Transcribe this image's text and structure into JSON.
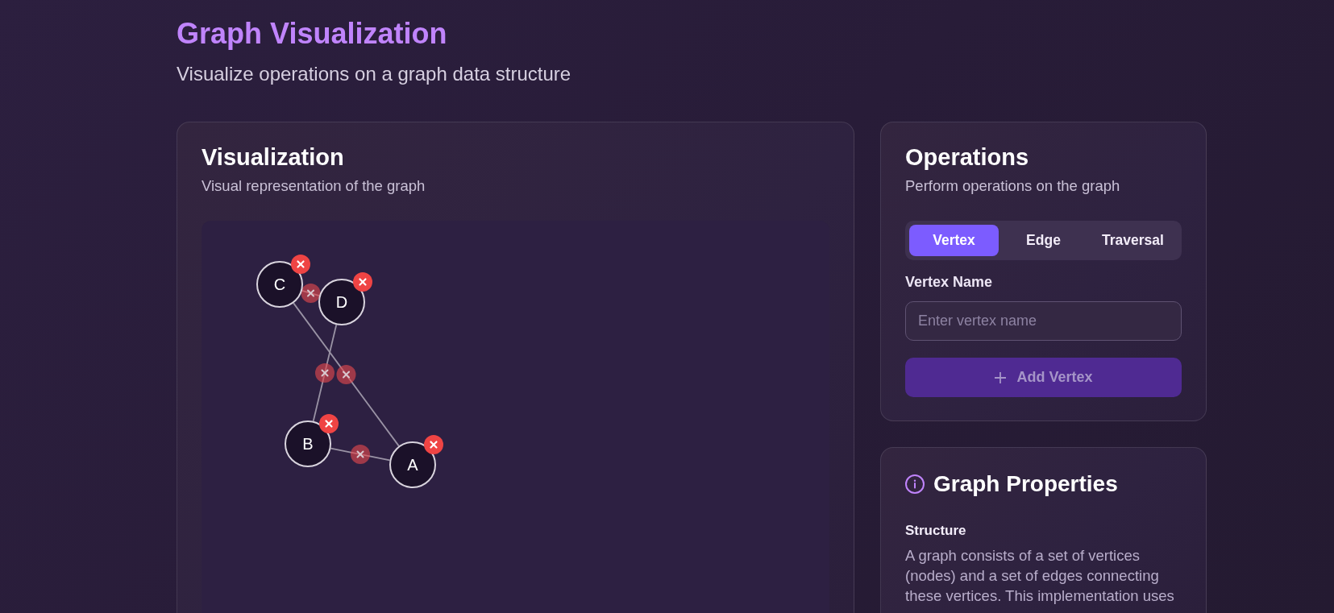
{
  "header": {
    "title": "Graph Visualization",
    "subtitle": "Visualize operations on a graph data structure"
  },
  "visualization": {
    "title": "Visualization",
    "subtitle": "Visual representation of the graph",
    "vertices": [
      {
        "label": "A"
      },
      {
        "label": "B"
      },
      {
        "label": "C"
      },
      {
        "label": "D"
      }
    ]
  },
  "operations": {
    "title": "Operations",
    "subtitle": "Perform operations on the graph",
    "tabs": [
      {
        "label": "Vertex",
        "selected": true
      },
      {
        "label": "Edge",
        "selected": false
      },
      {
        "label": "Traversal",
        "selected": false
      }
    ],
    "field": {
      "label": "Vertex Name",
      "placeholder": "Enter vertex name"
    },
    "button": {
      "label": "Add Vertex",
      "disabled": true
    }
  },
  "properties": {
    "title": "Graph Properties",
    "sections": [
      {
        "heading": "Structure",
        "text": "A graph consists of a set of vertices (nodes) and a set of edges connecting these vertices. This implementation uses"
      }
    ]
  }
}
